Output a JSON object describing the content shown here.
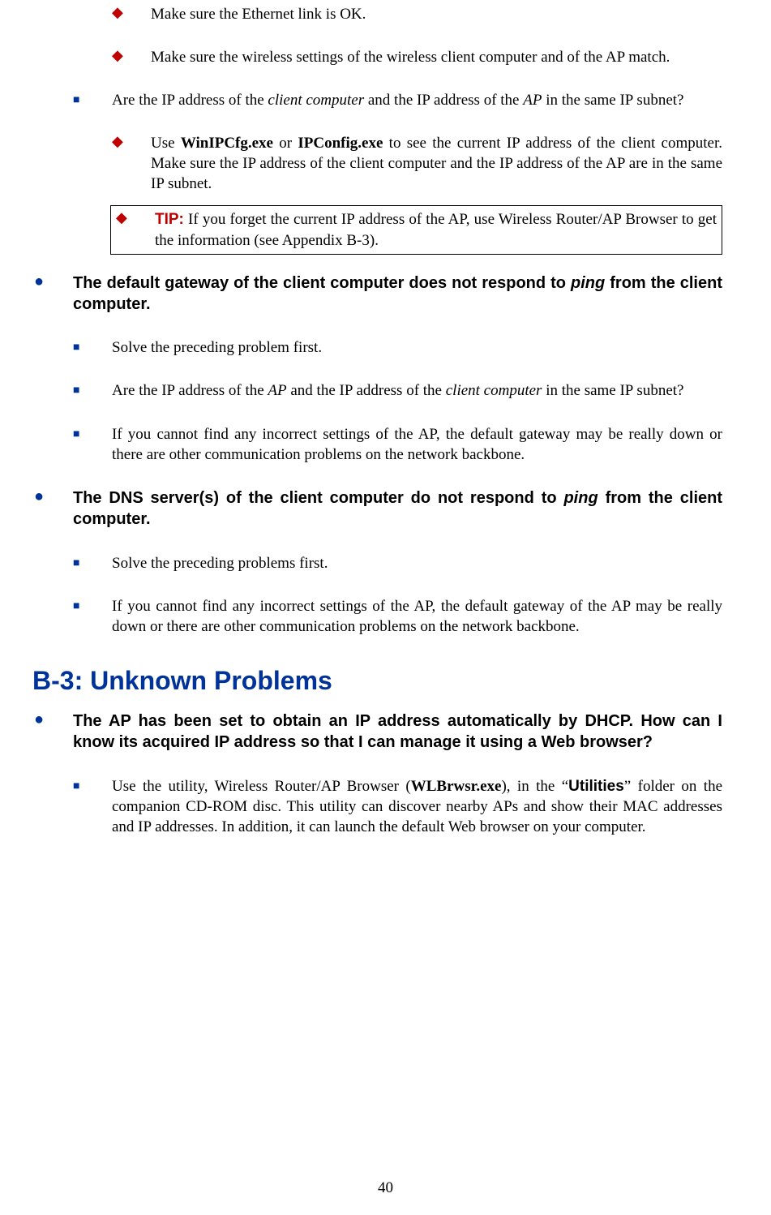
{
  "items": {
    "d1": "Make sure the Ethernet link is OK.",
    "d2": "Make sure the wireless settings of the wireless client computer and of the AP match.",
    "sq1_pre": "Are the IP address of the ",
    "sq1_em1": "client computer",
    "sq1_mid": " and the IP address of the ",
    "sq1_em2": "AP",
    "sq1_post": " in the same IP subnet?",
    "d3_pre": "Use ",
    "d3_b1": "WinIPCfg.exe",
    "d3_mid1": " or ",
    "d3_b2": "IPConfig.exe",
    "d3_post": " to see the current IP address of the client computer. Make sure the IP address of the client computer and the IP address of the AP are in the same IP subnet.",
    "tip_label": "TIP:",
    "tip_text": " If you forget the current IP address of the AP, use Wireless Router/AP Browser to get the information (see Appendix B-3).",
    "h1_pre": "The default gateway of the client computer does not respond to ",
    "h1_em": "ping",
    "h1_post": " from the client computer.",
    "sq2": "Solve the preceding problem first.",
    "sq3_pre": "Are the IP address of the ",
    "sq3_em1": "AP",
    "sq3_mid": " and the IP address of the ",
    "sq3_em2": "client computer",
    "sq3_post": " in the same IP subnet?",
    "sq4": "If you cannot find any incorrect settings of the AP, the default gateway may be really down or there are other communication problems on the network backbone.",
    "h2_pre": "The DNS server(s) of the client computer do not respond to ",
    "h2_em": "ping",
    "h2_post": " from the client computer.",
    "sq5": "Solve the preceding problems first.",
    "sq6": "If you cannot find any incorrect settings of the AP, the default gateway of the AP may be really down or there are other communication problems on the network backbone.",
    "section_title": "B-3: Unknown Problems",
    "h3": "The AP has been set to obtain an IP address automatically by DHCP. How can I know its acquired IP address so that I can manage it using a Web browser?",
    "sq7_pre": "Use the utility, Wireless Router/AP Browser (",
    "sq7_b1": "WLBrwsr.exe",
    "sq7_mid1": "), in the “",
    "sq7_b2": "Utilities",
    "sq7_post": "” folder on the companion CD-ROM disc. This utility can discover nearby APs and show their MAC addresses and IP addresses. In addition, it can launch the default Web browser on your computer."
  },
  "page_number": "40"
}
